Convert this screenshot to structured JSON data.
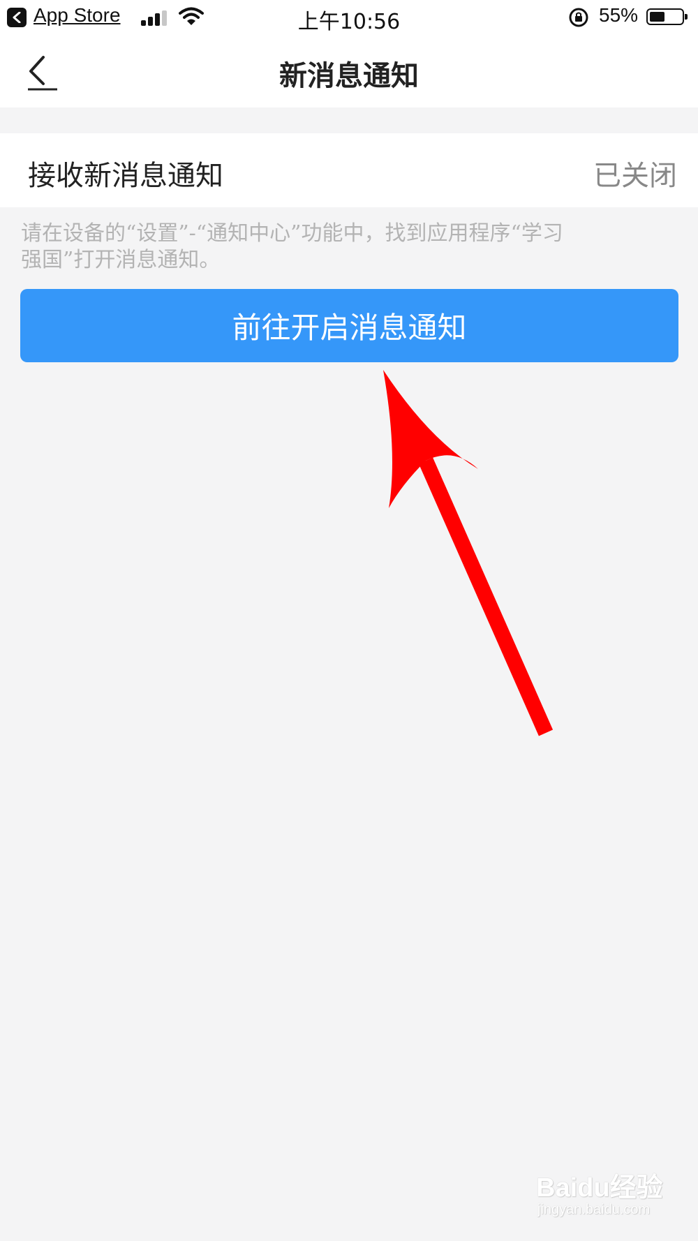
{
  "status_bar": {
    "back_app_label": "App Store",
    "time": "上午10:56",
    "battery_percent_text": "55%",
    "battery_level": 0.55,
    "icons": [
      "back-arrow-icon",
      "signal-icon",
      "wifi-icon",
      "rotation-lock-icon",
      "battery-icon"
    ]
  },
  "nav": {
    "title": "新消息通知",
    "back_icon": "chevron-left-icon"
  },
  "setting": {
    "label": "接收新消息通知",
    "value": "已关闭"
  },
  "hint": {
    "line1": "请在设备的“设置”-“通知中心”功能中，找到应用程序“学习",
    "line2": "强国”打开消息通知。"
  },
  "button": {
    "label": "前往开启消息通知"
  },
  "annotation": {
    "arrow_color": "#ff0000"
  },
  "watermark": {
    "logo_text": "Baidu经验",
    "url_text": "jingyan.baidu.com"
  },
  "colors": {
    "accent": "#3597f9",
    "background": "#f4f4f5",
    "surface": "#ffffff",
    "muted_text": "#b3b3b3"
  }
}
